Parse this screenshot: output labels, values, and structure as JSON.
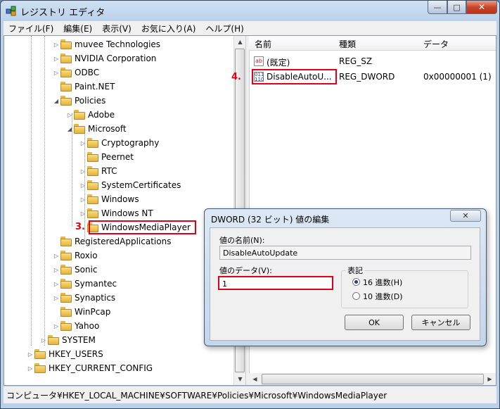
{
  "window": {
    "title": "レジストリ エディタ",
    "min": "—",
    "max": "□",
    "close": "✕"
  },
  "menu": [
    "ファイル(F)",
    "編集(E)",
    "表示(V)",
    "お気に入り(A)",
    "ヘルプ(H)"
  ],
  "tree": [
    {
      "label": "muvee Technologies",
      "exp": "▷"
    },
    {
      "label": "NVIDIA Corporation",
      "exp": "▷"
    },
    {
      "label": "ODBC",
      "exp": "▷"
    },
    {
      "label": "Paint.NET",
      "exp": ""
    },
    {
      "label": "Policies",
      "exp": "◢"
    },
    {
      "label": "Adobe",
      "exp": "▷"
    },
    {
      "label": "Microsoft",
      "exp": "◢"
    },
    {
      "label": "Cryptography",
      "exp": "▷"
    },
    {
      "label": "Peernet",
      "exp": ""
    },
    {
      "label": "RTC",
      "exp": "▷"
    },
    {
      "label": "SystemCertificates",
      "exp": "▷"
    },
    {
      "label": "Windows",
      "exp": "▷"
    },
    {
      "label": "Windows NT",
      "exp": "▷"
    },
    {
      "label": "WindowsMediaPlayer",
      "exp": ""
    },
    {
      "label": "RegisteredApplications",
      "exp": ""
    },
    {
      "label": "Roxio",
      "exp": "▷"
    },
    {
      "label": "Sonic",
      "exp": "▷"
    },
    {
      "label": "Symantec",
      "exp": "▷"
    },
    {
      "label": "Synaptics",
      "exp": "▷"
    },
    {
      "label": "WinPcap",
      "exp": ""
    },
    {
      "label": "Yahoo",
      "exp": "▷"
    },
    {
      "label": "SYSTEM",
      "exp": "▷"
    },
    {
      "label": "HKEY_USERS",
      "exp": "▷"
    },
    {
      "label": "HKEY_CURRENT_CONFIG",
      "exp": "▷"
    }
  ],
  "list": {
    "headers": {
      "name": "名前",
      "type": "種類",
      "data": "データ"
    },
    "rows": [
      {
        "icon": "ab",
        "name": "(既定)",
        "type": "REG_SZ",
        "data": ""
      },
      {
        "icon": "011 110",
        "name": "DisableAutoU...",
        "type": "REG_DWORD",
        "data": "0x00000001 (1)"
      }
    ]
  },
  "scroll": {
    "up": "▲",
    "down": "▼",
    "left": "◀",
    "right": "▶"
  },
  "steps": {
    "three": "3.",
    "four": "4."
  },
  "status": "コンピュータ¥HKEY_LOCAL_MACHINE¥SOFTWARE¥Policies¥Microsoft¥WindowsMediaPlayer",
  "dialog": {
    "title": "DWORD (32 ビット) 値の編集",
    "close": "✕",
    "name_label": "値の名前(N):",
    "name_value": "DisableAutoUpdate",
    "data_label": "値のデータ(V):",
    "data_value": "1",
    "base_label": "表記",
    "radio_hex": "16 進数(H)",
    "radio_dec": "10 進数(D)",
    "ok": "OK",
    "cancel": "キャンセル"
  },
  "colors": {
    "accent_red": "#e0001a",
    "selection": "#3399ff"
  }
}
